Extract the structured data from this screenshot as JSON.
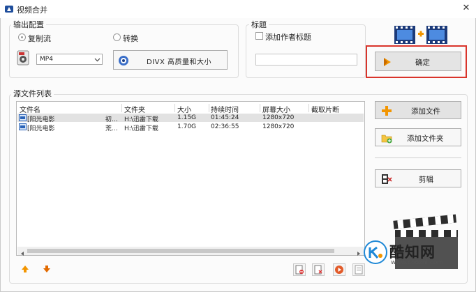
{
  "window": {
    "title": "视频合并",
    "close_glyph": "✕"
  },
  "output": {
    "group_label": "输出配置",
    "radio_copy": "复制流",
    "radio_convert": "转换",
    "format_value": "MP4",
    "profile_label": "DIVX 高质量和大小"
  },
  "title_section": {
    "group_label": "标题",
    "add_author_title": "添加作者标题",
    "title_input_value": ""
  },
  "confirm_button": "确定",
  "source_list": {
    "group_label": "源文件列表",
    "columns": [
      "文件名",
      "文件夹",
      "大小",
      "持续时间",
      "屏幕大小",
      "截取片断"
    ],
    "rows": [
      {
        "name": "[阳光电影",
        "name2": "初...",
        "folder": "H:\\迅雷下载",
        "size": "1.15G",
        "duration": "01:45:24",
        "screen": "1280x720",
        "clip": ""
      },
      {
        "name": "[阳光电影",
        "name2": "荒...",
        "folder": "H:\\迅雷下载",
        "size": "1.70G",
        "duration": "02:36:55",
        "screen": "1280x720",
        "clip": ""
      }
    ]
  },
  "side_buttons": {
    "add_file": "添加文件",
    "add_folder": "添加文件夹",
    "cut": "剪辑"
  },
  "watermark": {
    "brand": "酷知网",
    "url": "www.coozhi.com"
  },
  "colors": {
    "highlight_border": "#d9342b",
    "plus_orange": "#f29500",
    "film_blue": "#2a63b8"
  }
}
